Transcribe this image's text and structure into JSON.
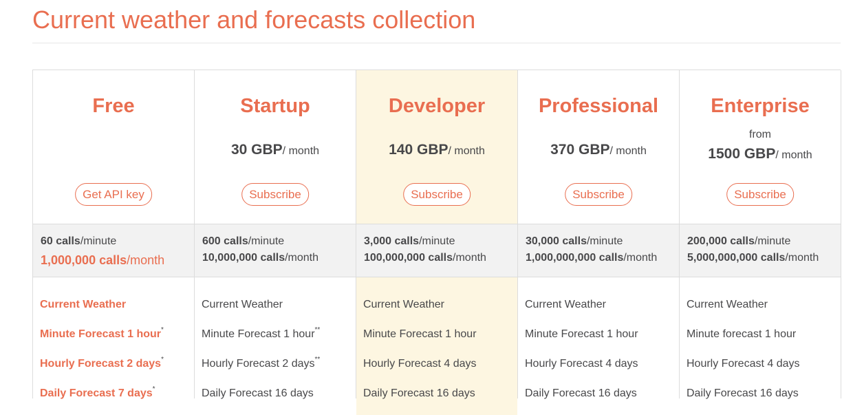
{
  "page": {
    "title": "Current weather and forecasts collection"
  },
  "plans": [
    {
      "name": "Free",
      "from": "",
      "price_amount": "",
      "price_unit": "",
      "button": "Get API key",
      "limits": {
        "per_minute_value": "60 calls",
        "per_minute_unit": "/minute",
        "per_month_value": "1,000,000 calls",
        "per_month_unit": "/month"
      },
      "features": [
        {
          "text": "Current Weather",
          "note": ""
        },
        {
          "text": "Minute Forecast 1 hour",
          "note": "*"
        },
        {
          "text": "Hourly Forecast 2 days",
          "note": "*"
        },
        {
          "text": "Daily Forecast 7 days",
          "note": "*"
        }
      ]
    },
    {
      "name": "Startup",
      "from": "",
      "price_amount": "30 GBP",
      "price_unit": "/ month",
      "button": "Subscribe",
      "limits": {
        "per_minute_value": "600 calls",
        "per_minute_unit": "/minute",
        "per_month_value": "10,000,000 calls",
        "per_month_unit": "/month"
      },
      "features": [
        {
          "text": "Current Weather",
          "note": ""
        },
        {
          "text": "Minute Forecast 1 hour",
          "note": "**"
        },
        {
          "text": "Hourly Forecast 2 days",
          "note": "**"
        },
        {
          "text": "Daily Forecast 16 days",
          "note": ""
        }
      ]
    },
    {
      "name": "Developer",
      "from": "",
      "price_amount": "140 GBP",
      "price_unit": "/ month",
      "button": "Subscribe",
      "limits": {
        "per_minute_value": "3,000 calls",
        "per_minute_unit": "/minute",
        "per_month_value": "100,000,000 calls",
        "per_month_unit": "/month"
      },
      "features": [
        {
          "text": "Current Weather",
          "note": ""
        },
        {
          "text": "Minute Forecast 1 hour",
          "note": ""
        },
        {
          "text": "Hourly Forecast 4 days",
          "note": ""
        },
        {
          "text": "Daily Forecast 16 days",
          "note": ""
        }
      ]
    },
    {
      "name": "Professional",
      "from": "",
      "price_amount": "370 GBP",
      "price_unit": "/ month",
      "button": "Subscribe",
      "limits": {
        "per_minute_value": "30,000 calls",
        "per_minute_unit": "/minute",
        "per_month_value": "1,000,000,000 calls",
        "per_month_unit": "/month"
      },
      "features": [
        {
          "text": "Current Weather",
          "note": ""
        },
        {
          "text": "Minute Forecast 1 hour",
          "note": ""
        },
        {
          "text": "Hourly Forecast 4 days",
          "note": ""
        },
        {
          "text": "Daily Forecast 16 days",
          "note": ""
        }
      ]
    },
    {
      "name": "Enterprise",
      "from": "from",
      "price_amount": "1500 GBP",
      "price_unit": "/ month",
      "button": "Subscribe",
      "limits": {
        "per_minute_value": "200,000 calls",
        "per_minute_unit": "/minute",
        "per_month_value": "5,000,000,000 calls",
        "per_month_unit": "/month"
      },
      "features": [
        {
          "text": "Current Weather",
          "note": ""
        },
        {
          "text": "Minute forecast 1 hour",
          "note": ""
        },
        {
          "text": "Hourly Forecast 4 days",
          "note": ""
        },
        {
          "text": "Daily Forecast 16 days",
          "note": ""
        }
      ]
    }
  ],
  "colors": {
    "accent": "#e96e50",
    "text": "#48484a",
    "highlight_bg": "#fdf6e1",
    "limits_bg": "#f2f2f2",
    "border": "#dcdcdc"
  }
}
